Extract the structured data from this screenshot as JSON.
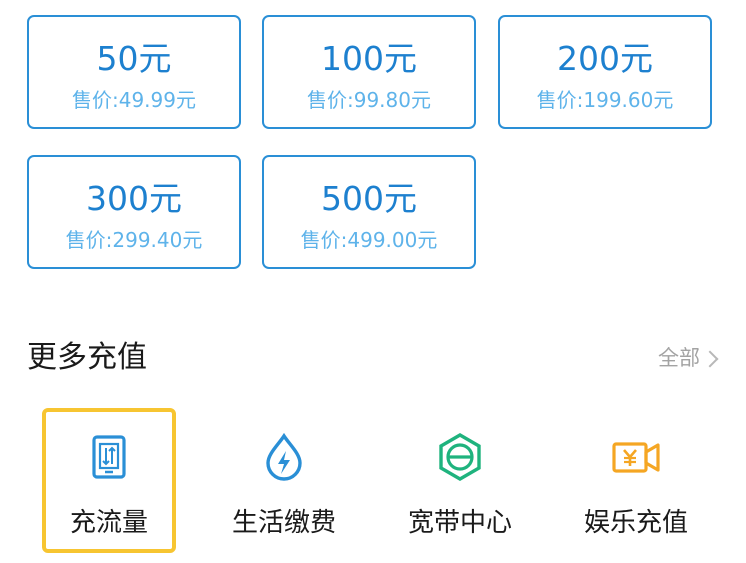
{
  "recharge_options": [
    {
      "amount": "50元",
      "price": "售价:49.99元"
    },
    {
      "amount": "100元",
      "price": "售价:99.80元"
    },
    {
      "amount": "200元",
      "price": "售价:199.60元"
    },
    {
      "amount": "300元",
      "price": "售价:299.40元"
    },
    {
      "amount": "500元",
      "price": "售价:499.00元"
    }
  ],
  "more_section": {
    "title": "更多充值",
    "all_label": "全部"
  },
  "services": [
    {
      "label": "充流量",
      "icon": "phone-data-icon",
      "color": "#2a8fd6",
      "selected": true
    },
    {
      "label": "生活缴费",
      "icon": "water-lightning-icon",
      "color": "#2a8fd6",
      "selected": false
    },
    {
      "label": "宽带中心",
      "icon": "broadband-e-icon",
      "color": "#1fb37e",
      "selected": false
    },
    {
      "label": "娱乐充值",
      "icon": "video-yen-icon",
      "color": "#f5a623",
      "selected": false
    }
  ],
  "colors": {
    "accent": "#1d80cf",
    "card_border": "#2a8fd6",
    "price_text": "#5eb3ea",
    "highlight": "#f7c531"
  }
}
